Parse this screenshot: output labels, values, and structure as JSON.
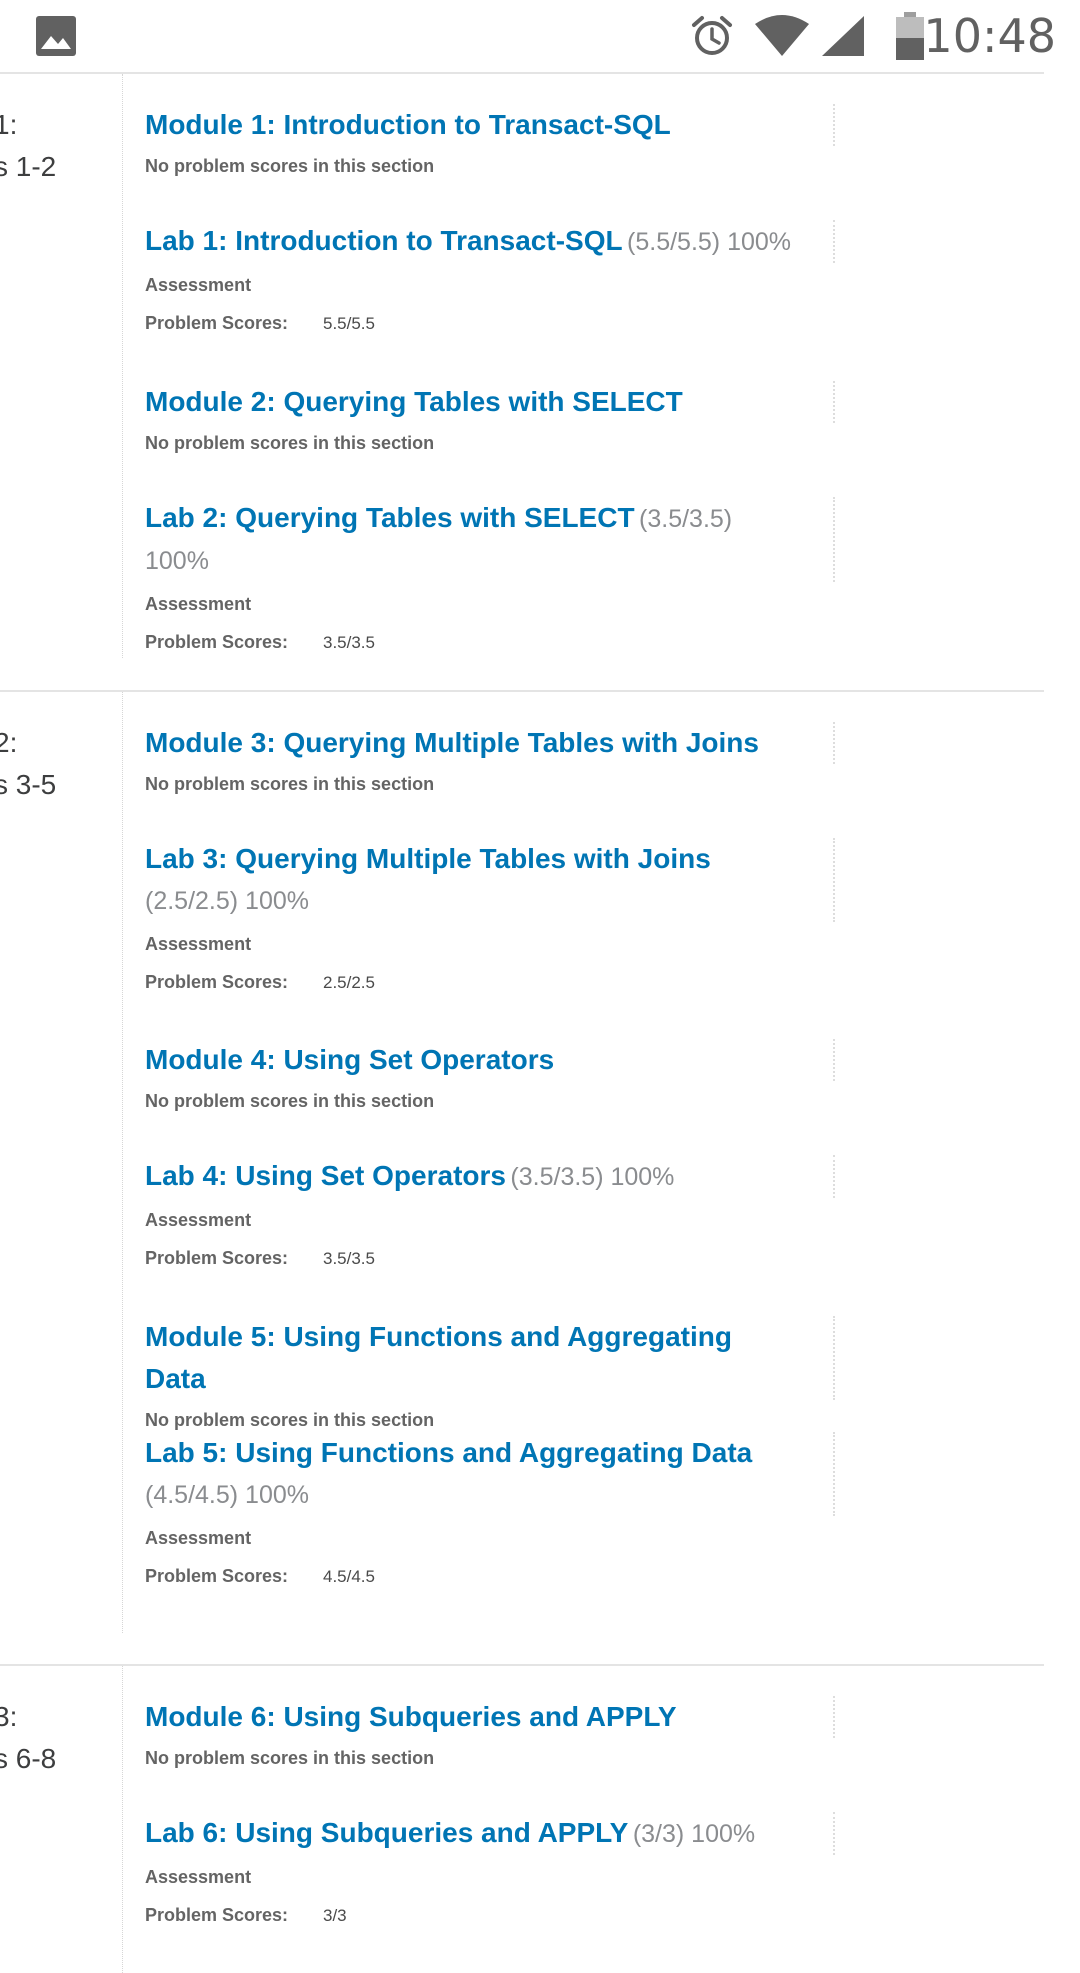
{
  "status_bar": {
    "time": "10:48",
    "icons": [
      "image-notification-icon",
      "alarm-icon",
      "wifi-icon",
      "cell-signal-icon",
      "battery-icon"
    ]
  },
  "labels": {
    "no_scores": "No problem scores in this section",
    "assessment": "Assessment",
    "problem_scores": "Problem Scores:"
  },
  "chapters": [
    {
      "label": "1:\ns 1-2",
      "sections": [
        {
          "title": "Module 1: Introduction to Transact-SQL",
          "graded": false
        },
        {
          "title": "Lab 1: Introduction to Transact-SQL",
          "graded": true,
          "score": "(5.5/5.5) 100%",
          "problem_scores": "5.5/5.5"
        },
        {
          "title": "Module 2: Querying Tables with SELECT",
          "graded": false
        },
        {
          "title": "Lab 2: Querying Tables with SELECT",
          "graded": true,
          "score": "(3.5/3.5) 100%",
          "problem_scores": "3.5/3.5"
        }
      ]
    },
    {
      "label": "2:\ns 3-5",
      "sections": [
        {
          "title": "Module 3: Querying Multiple Tables with Joins",
          "graded": false
        },
        {
          "title": "Lab 3: Querying Multiple Tables with Joins",
          "graded": true,
          "score": "(2.5/2.5) 100%",
          "problem_scores": "2.5/2.5"
        },
        {
          "title": "Module 4: Using Set Operators",
          "graded": false
        },
        {
          "title": "Lab 4: Using Set Operators",
          "graded": true,
          "score": "(3.5/3.5) 100%",
          "problem_scores": "3.5/3.5"
        },
        {
          "title": "Module 5: Using Functions and Aggregating Data",
          "graded": false
        },
        {
          "title": "Lab 5: Using Functions and Aggregating Data",
          "graded": true,
          "score": "(4.5/4.5) 100%",
          "problem_scores": "4.5/4.5"
        }
      ]
    },
    {
      "label": "3:\ns 6-8",
      "sections": [
        {
          "title": "Module 6: Using Subqueries and APPLY",
          "graded": false
        },
        {
          "title": "Lab 6: Using Subqueries and APPLY",
          "graded": true,
          "score": "(3/3) 100%",
          "problem_scores": "3/3"
        }
      ]
    }
  ]
}
